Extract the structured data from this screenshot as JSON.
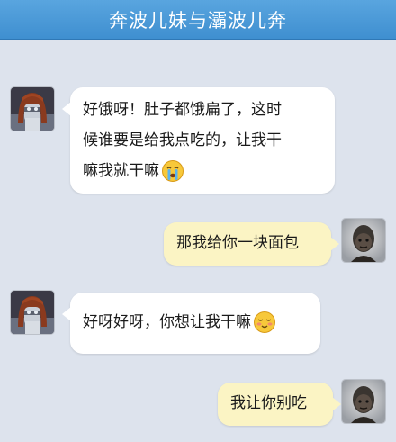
{
  "header": {
    "title": "奔波儿妹与灞波儿奔"
  },
  "messages": [
    {
      "side": "left",
      "sender_avatar": "girl-avatar",
      "lines": [
        "好饿呀！肚子都饿扁了，这时",
        "候谁要是给我点吃的，让我干",
        "嘛我就干嘛"
      ],
      "emoji": "crying-face-icon"
    },
    {
      "side": "right",
      "sender_avatar": "monk-avatar",
      "lines": [
        "那我给你一块面包"
      ]
    },
    {
      "side": "left",
      "sender_avatar": "girl-avatar",
      "lines": [
        "好呀好呀，你想让我干嘛"
      ],
      "emoji": "shy-smile-icon"
    },
    {
      "side": "right",
      "sender_avatar": "monk-avatar",
      "lines": [
        "我让你别吃"
      ]
    }
  ],
  "colors": {
    "header": "#4a9ad8",
    "background": "#dde3ed",
    "left_bubble": "#ffffff",
    "right_bubble": "#fbf4c4"
  }
}
